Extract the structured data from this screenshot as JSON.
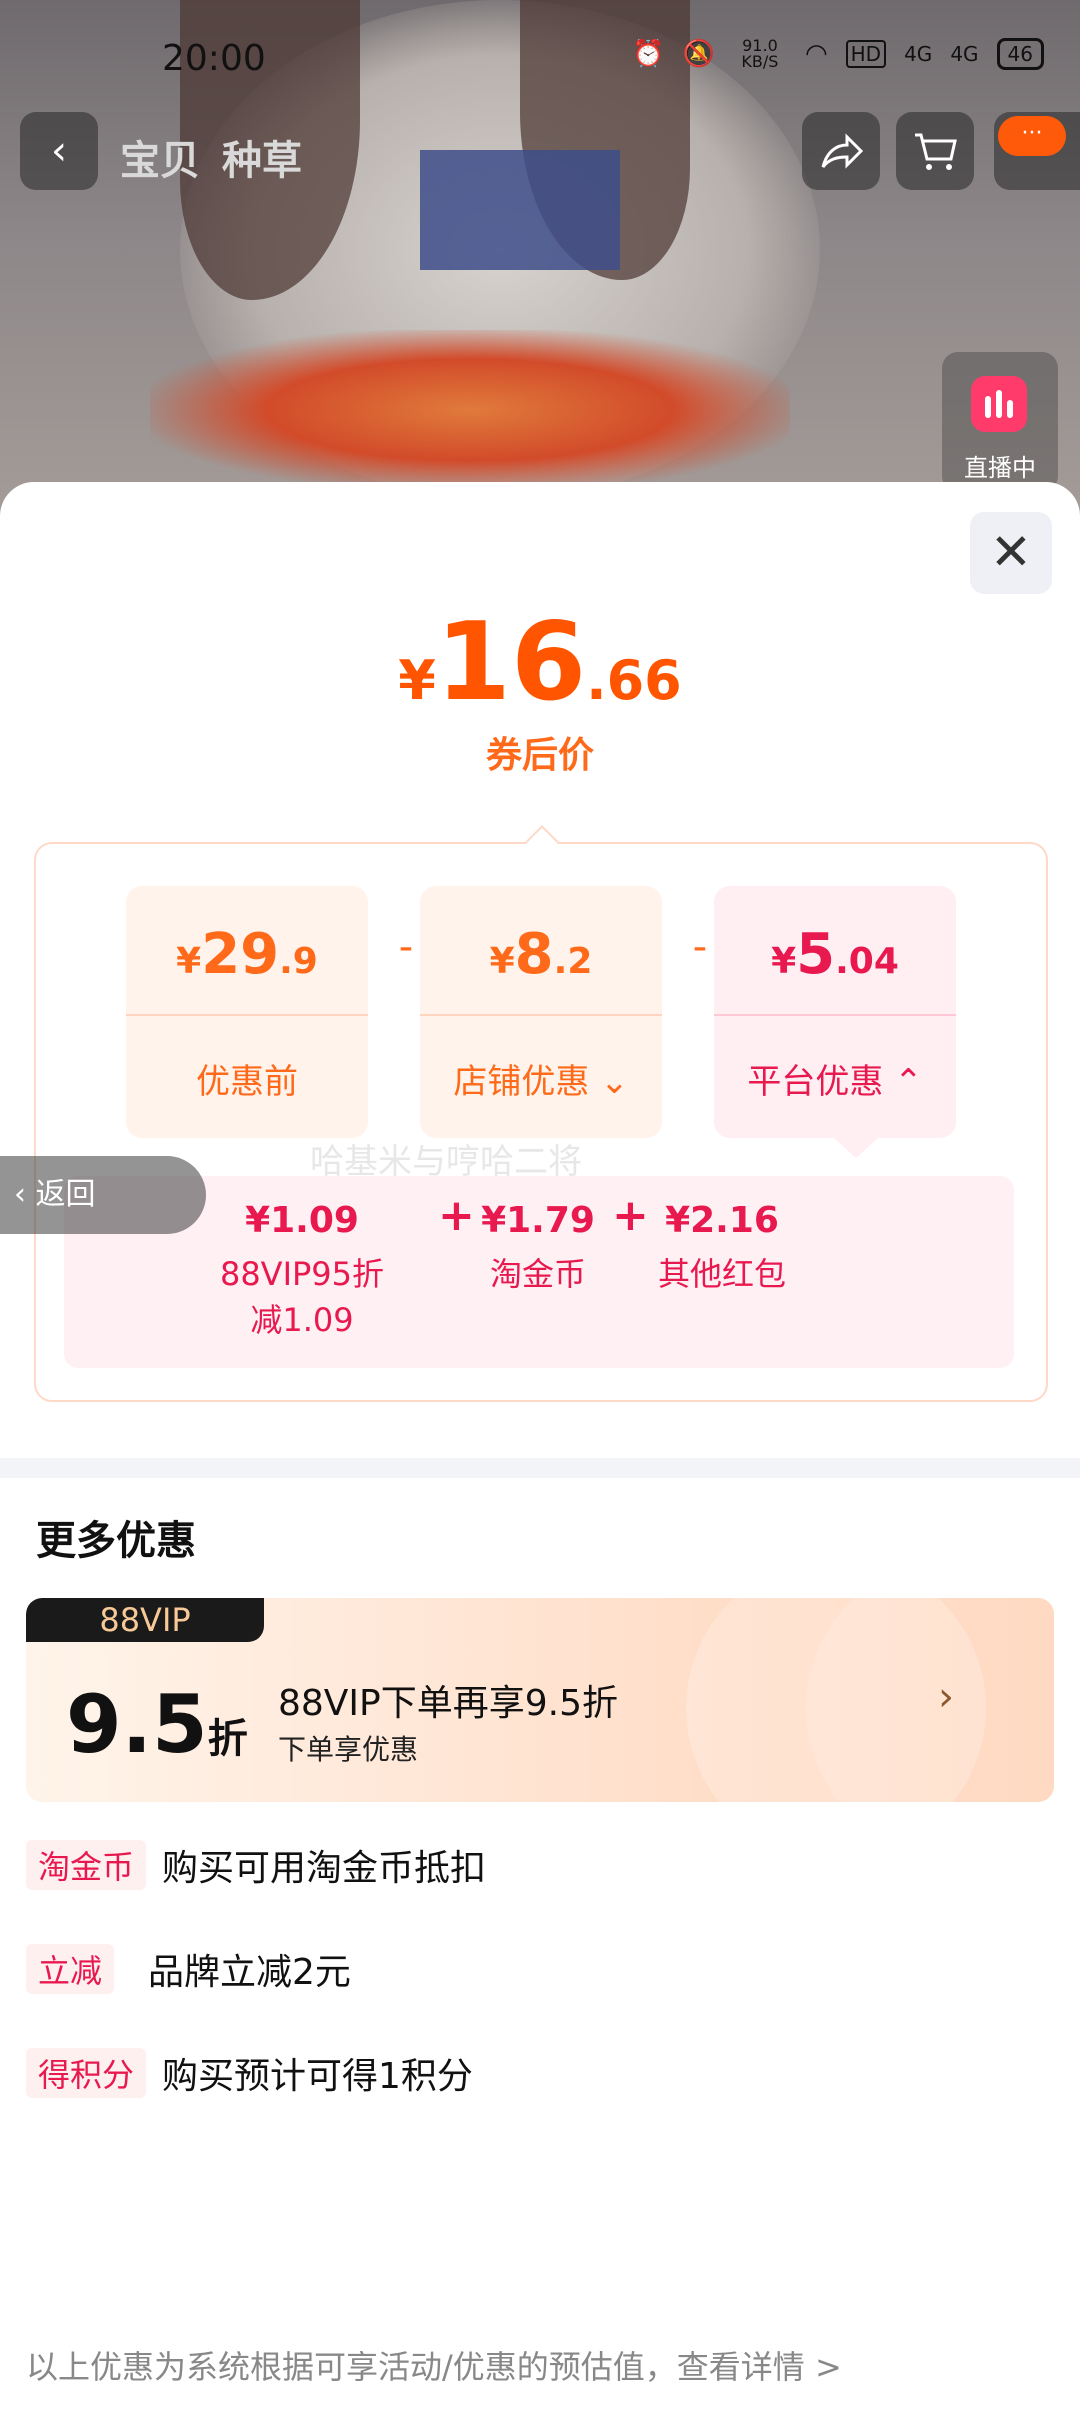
{
  "status": {
    "time": "20:00",
    "net_speed": "91.0 KB/S",
    "hd": "HD",
    "sig1": "4G",
    "sig2": "4G",
    "battery": "46"
  },
  "nav": {
    "back_icon": "‹",
    "tab1": "宝贝",
    "tab2": "种草",
    "share_icon": "share-icon",
    "cart_icon": "cart-icon",
    "badge": "···"
  },
  "live": {
    "label": "直播中"
  },
  "sheet": {
    "close_icon": "✕",
    "final_price": {
      "currency": "¥",
      "integer": "16",
      "decimal": ".66",
      "label": "券后价"
    },
    "cards": [
      {
        "currency": "¥",
        "integer": "29",
        "decimal": ".9",
        "label": "优惠前"
      },
      {
        "currency": "¥",
        "integer": "8",
        "decimal": ".2",
        "label": "店铺优惠",
        "chevron": "⌄"
      },
      {
        "currency": "¥",
        "integer": "5",
        "decimal": ".04",
        "label": "平台优惠",
        "chevron": "⌃"
      }
    ],
    "minus": "-",
    "plus": "+",
    "platform_items": [
      {
        "amount": "¥1.09",
        "desc_line1": "88VIP95折",
        "desc_line2": "减1.09"
      },
      {
        "amount": "¥1.79",
        "desc_line1": "淘金币",
        "desc_line2": ""
      },
      {
        "amount": "¥2.16",
        "desc_line1": "其他红包",
        "desc_line2": ""
      }
    ],
    "watermark": "哈基米与哼哈二将",
    "more_title": "更多优惠",
    "vip": {
      "tag": "88VIP",
      "discount": "9.5",
      "unit": "折",
      "main": "88VIP下单再享9.5折",
      "sub": "下单享优惠",
      "arrow": "›"
    },
    "back": "返回",
    "offers": [
      {
        "tag": "淘金币",
        "text": "购买可用淘金币抵扣"
      },
      {
        "tag": "立减",
        "text": "品牌立减2元"
      },
      {
        "tag": "得积分",
        "text": "购买预计可得1积分"
      }
    ],
    "footer": "以上优惠为系统根据可享活动/优惠的预估值，查看详情 >"
  }
}
